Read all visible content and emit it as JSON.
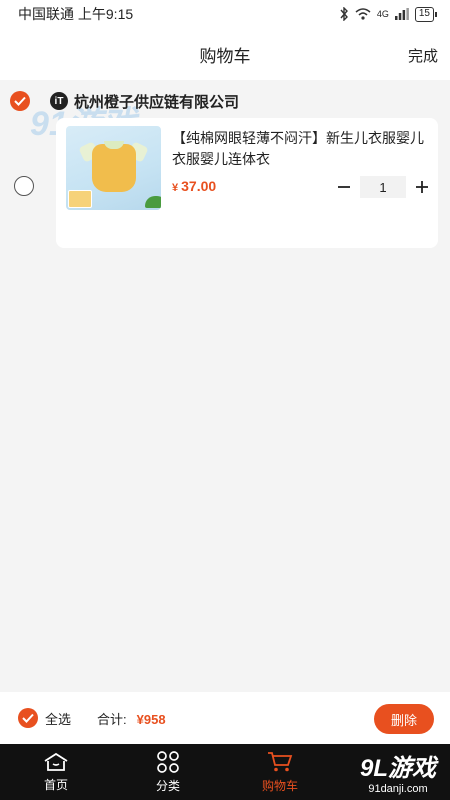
{
  "status_bar": {
    "carrier": "中国联通 上午9:15",
    "network": "4G",
    "battery": "15"
  },
  "header": {
    "title": "购物车",
    "done": "完成"
  },
  "shop": {
    "name": "杭州橙子供应链有限公司",
    "icon_text": "iT",
    "selected": true
  },
  "cart_items": [
    {
      "title": "【纯棉网眼轻薄不闷汗】新生儿衣服婴儿衣服婴儿连体衣",
      "currency": "¥",
      "price": "37.00",
      "quantity": "1",
      "selected": false
    }
  ],
  "footer": {
    "select_all": "全选",
    "total_label": "合计:",
    "total_amount": "¥958",
    "delete": "删除"
  },
  "tabbar": [
    {
      "label": "首页",
      "icon": "home-icon"
    },
    {
      "label": "分类",
      "icon": "category-icon"
    },
    {
      "label": "购物车",
      "icon": "cart-icon"
    }
  ],
  "watermarks": {
    "top_logo": "91游戏",
    "top_logo_url": "91danji.com",
    "bottom_logo": "9L游戏",
    "bottom_logo_url": "91danji.com"
  },
  "colors": {
    "accent": "#e8501f",
    "tabbar_bg": "#111111"
  }
}
